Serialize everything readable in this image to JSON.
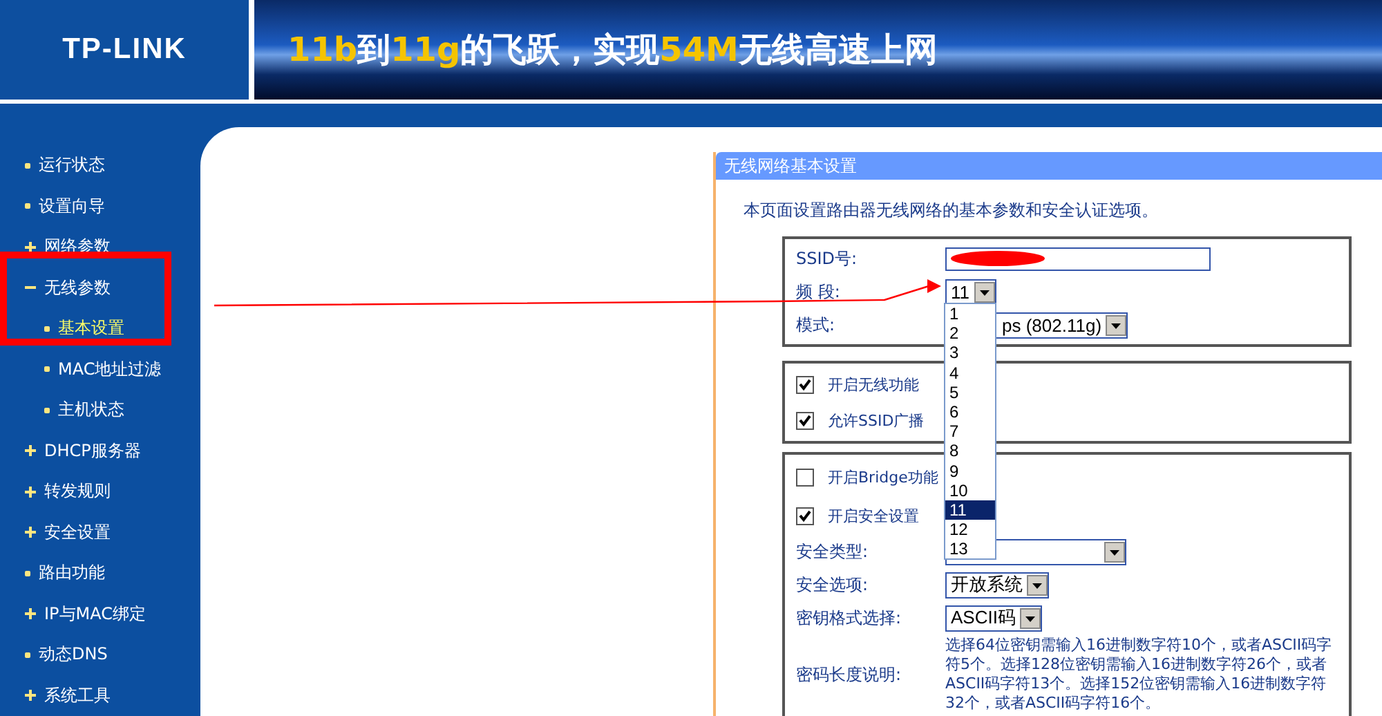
{
  "header": {
    "logo": "TP-LINK",
    "slogan": [
      {
        "text": "11b",
        "kind": "highlight"
      },
      {
        "text": "到",
        "kind": "plain"
      },
      {
        "text": "11g",
        "kind": "highlight"
      },
      {
        "text": "的飞跃，实现",
        "kind": "plain"
      },
      {
        "text": "54M",
        "kind": "highlight"
      },
      {
        "text": "无线高速上网",
        "kind": "plain"
      }
    ]
  },
  "sidebar": {
    "items": [
      {
        "label": "运行状态",
        "kind": "leaf"
      },
      {
        "label": "设置向导",
        "kind": "leaf"
      },
      {
        "label": "网络参数",
        "kind": "group",
        "expanded": false
      },
      {
        "label": "无线参数",
        "kind": "group",
        "expanded": true,
        "children": [
          {
            "label": "基本设置",
            "selected": true
          },
          {
            "label": "MAC地址过滤",
            "selected": false
          },
          {
            "label": "主机状态",
            "selected": false
          }
        ]
      },
      {
        "label": "DHCP服务器",
        "kind": "group",
        "expanded": false
      },
      {
        "label": "转发规则",
        "kind": "group",
        "expanded": false
      },
      {
        "label": "安全设置",
        "kind": "group",
        "expanded": false
      },
      {
        "label": "路由功能",
        "kind": "leaf"
      },
      {
        "label": "IP与MAC绑定",
        "kind": "group",
        "expanded": false
      },
      {
        "label": "动态DNS",
        "kind": "leaf"
      },
      {
        "label": "系统工具",
        "kind": "group",
        "expanded": false
      }
    ]
  },
  "panel": {
    "title": "无线网络基本设置",
    "description": "本页面设置路由器无线网络的基本参数和安全认证选项。",
    "basic": [
      {
        "label": "SSID号:",
        "kind": "text"
      },
      {
        "label": "频 段:",
        "kind": "select",
        "value": "11"
      },
      {
        "label": "模式:",
        "kind": "select",
        "value": "ps (802.11g)"
      }
    ],
    "switches": [
      {
        "label": "开启无线功能",
        "checked": true
      },
      {
        "label": "允许SSID广播",
        "checked": true
      }
    ],
    "security": {
      "switches": [
        {
          "label": "开启Bridge功能",
          "checked": false
        },
        {
          "label": "开启安全设置",
          "checked": true
        }
      ],
      "fields": [
        {
          "label": "安全类型:",
          "kind": "select"
        },
        {
          "label": "安全选项:",
          "kind": "select",
          "value": "开放系统"
        },
        {
          "label": "密钥格式选择:",
          "kind": "select",
          "value": "ASCII码"
        },
        {
          "label": "密码长度说明:",
          "kind": "note",
          "value": "选择64位密钥需输入16进制数字符10个，或者ASCII码字符5个。选择128位密钥需输入16进制数字符26个，或者ASCII码字符13个。选择152位密钥需输入16进制数字符32个，或者ASCII码字符16个。"
        }
      ]
    }
  },
  "channel_list": [
    {
      "label": "1",
      "selected": false
    },
    {
      "label": "2",
      "selected": false
    },
    {
      "label": "3",
      "selected": false
    },
    {
      "label": "4",
      "selected": false
    },
    {
      "label": "5",
      "selected": false
    },
    {
      "label": "6",
      "selected": false
    },
    {
      "label": "7",
      "selected": false
    },
    {
      "label": "8",
      "selected": false
    },
    {
      "label": "9",
      "selected": false
    },
    {
      "label": "10",
      "selected": false
    },
    {
      "label": "11",
      "selected": true
    },
    {
      "label": "12",
      "selected": false
    },
    {
      "label": "13",
      "selected": false
    }
  ]
}
